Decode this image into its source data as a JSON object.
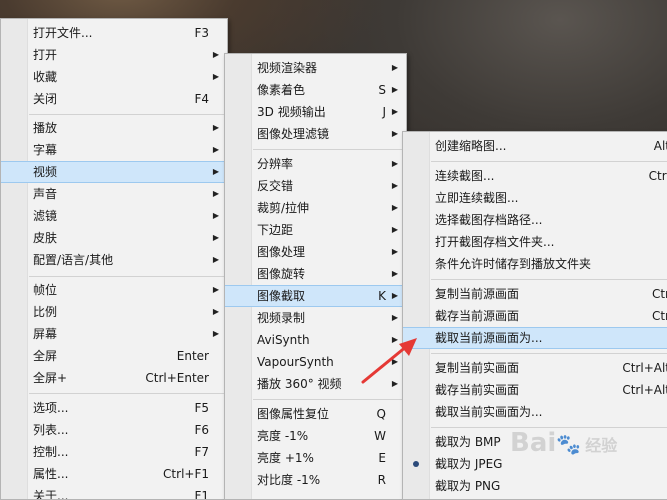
{
  "menu1": {
    "items": [
      {
        "label": "打开文件...",
        "shortcut": "F3",
        "arrow": false
      },
      {
        "label": "打开",
        "shortcut": "",
        "arrow": true
      },
      {
        "label": "收藏",
        "shortcut": "",
        "arrow": true
      },
      {
        "label": "关闭",
        "shortcut": "F4",
        "arrow": false
      },
      {
        "label": "播放",
        "shortcut": "",
        "arrow": true
      },
      {
        "label": "字幕",
        "shortcut": "",
        "arrow": true
      },
      {
        "label": "视频",
        "shortcut": "",
        "arrow": true
      },
      {
        "label": "声音",
        "shortcut": "",
        "arrow": true
      },
      {
        "label": "滤镜",
        "shortcut": "",
        "arrow": true
      },
      {
        "label": "皮肤",
        "shortcut": "",
        "arrow": true
      },
      {
        "label": "配置/语言/其他",
        "shortcut": "",
        "arrow": true
      },
      {
        "label": "帧位",
        "shortcut": "",
        "arrow": true
      },
      {
        "label": "比例",
        "shortcut": "",
        "arrow": true
      },
      {
        "label": "屏幕",
        "shortcut": "",
        "arrow": true
      },
      {
        "label": "全屏",
        "shortcut": "Enter",
        "arrow": false
      },
      {
        "label": "全屏+",
        "shortcut": "Ctrl+Enter",
        "arrow": false
      },
      {
        "label": "选项...",
        "shortcut": "F5",
        "arrow": false
      },
      {
        "label": "列表...",
        "shortcut": "F6",
        "arrow": false
      },
      {
        "label": "控制...",
        "shortcut": "F7",
        "arrow": false
      },
      {
        "label": "属性...",
        "shortcut": "Ctrl+F1",
        "arrow": false
      },
      {
        "label": "关于...",
        "shortcut": "F1",
        "arrow": false
      }
    ]
  },
  "menu2": {
    "items": [
      {
        "label": "视频渲染器",
        "shortcut": "",
        "arrow": true
      },
      {
        "label": "像素着色",
        "shortcut": "S",
        "arrow": true
      },
      {
        "label": "3D 视频输出",
        "shortcut": "J",
        "arrow": true
      },
      {
        "label": "图像处理滤镜",
        "shortcut": "",
        "arrow": true
      },
      {
        "label": "分辨率",
        "shortcut": "",
        "arrow": true
      },
      {
        "label": "反交错",
        "shortcut": "",
        "arrow": true
      },
      {
        "label": "裁剪/拉伸",
        "shortcut": "",
        "arrow": true
      },
      {
        "label": "下边距",
        "shortcut": "",
        "arrow": true
      },
      {
        "label": "图像处理",
        "shortcut": "",
        "arrow": true
      },
      {
        "label": "图像旋转",
        "shortcut": "",
        "arrow": true
      },
      {
        "label": "图像截取",
        "shortcut": "K",
        "arrow": true
      },
      {
        "label": "视频录制",
        "shortcut": "",
        "arrow": true
      },
      {
        "label": "AviSynth",
        "shortcut": "",
        "arrow": true
      },
      {
        "label": "VapourSynth",
        "shortcut": "",
        "arrow": true
      },
      {
        "label": "播放 360° 视频",
        "shortcut": "",
        "arrow": true
      },
      {
        "label": "图像属性复位",
        "shortcut": "Q",
        "arrow": false
      },
      {
        "label": "亮度 -1%",
        "shortcut": "W",
        "arrow": false
      },
      {
        "label": "亮度 +1%",
        "shortcut": "E",
        "arrow": false
      },
      {
        "label": "对比度 -1%",
        "shortcut": "R",
        "arrow": false
      }
    ]
  },
  "menu3": {
    "items": [
      {
        "label": "创建缩略图...",
        "shortcut": "Alt"
      },
      {
        "label": "连续截图...",
        "shortcut": "Ctrl"
      },
      {
        "label": "立即连续截图...",
        "shortcut": ""
      },
      {
        "label": "选择截图存档路径...",
        "shortcut": ""
      },
      {
        "label": "打开截图存档文件夹...",
        "shortcut": ""
      },
      {
        "label": "条件允许时储存到播放文件夹",
        "shortcut": ""
      },
      {
        "label": "复制当前源画面",
        "shortcut": "Ctr"
      },
      {
        "label": "截存当前源画面",
        "shortcut": "Ctr"
      },
      {
        "label": "截取当前源画面为...",
        "shortcut": ""
      },
      {
        "label": "复制当前实画面",
        "shortcut": "Ctrl+Alt"
      },
      {
        "label": "截存当前实画面",
        "shortcut": "Ctrl+Alt"
      },
      {
        "label": "截取当前实画面为...",
        "shortcut": ""
      },
      {
        "label": "截取为 BMP",
        "shortcut": ""
      },
      {
        "label": "截取为 JPEG",
        "shortcut": ""
      },
      {
        "label": "截取为 PNG",
        "shortcut": ""
      }
    ]
  },
  "watermark": {
    "text": "Bai",
    "text2": "经验"
  },
  "colors": {
    "highlight": "#cfe6fa",
    "arrow": "#e53935"
  }
}
